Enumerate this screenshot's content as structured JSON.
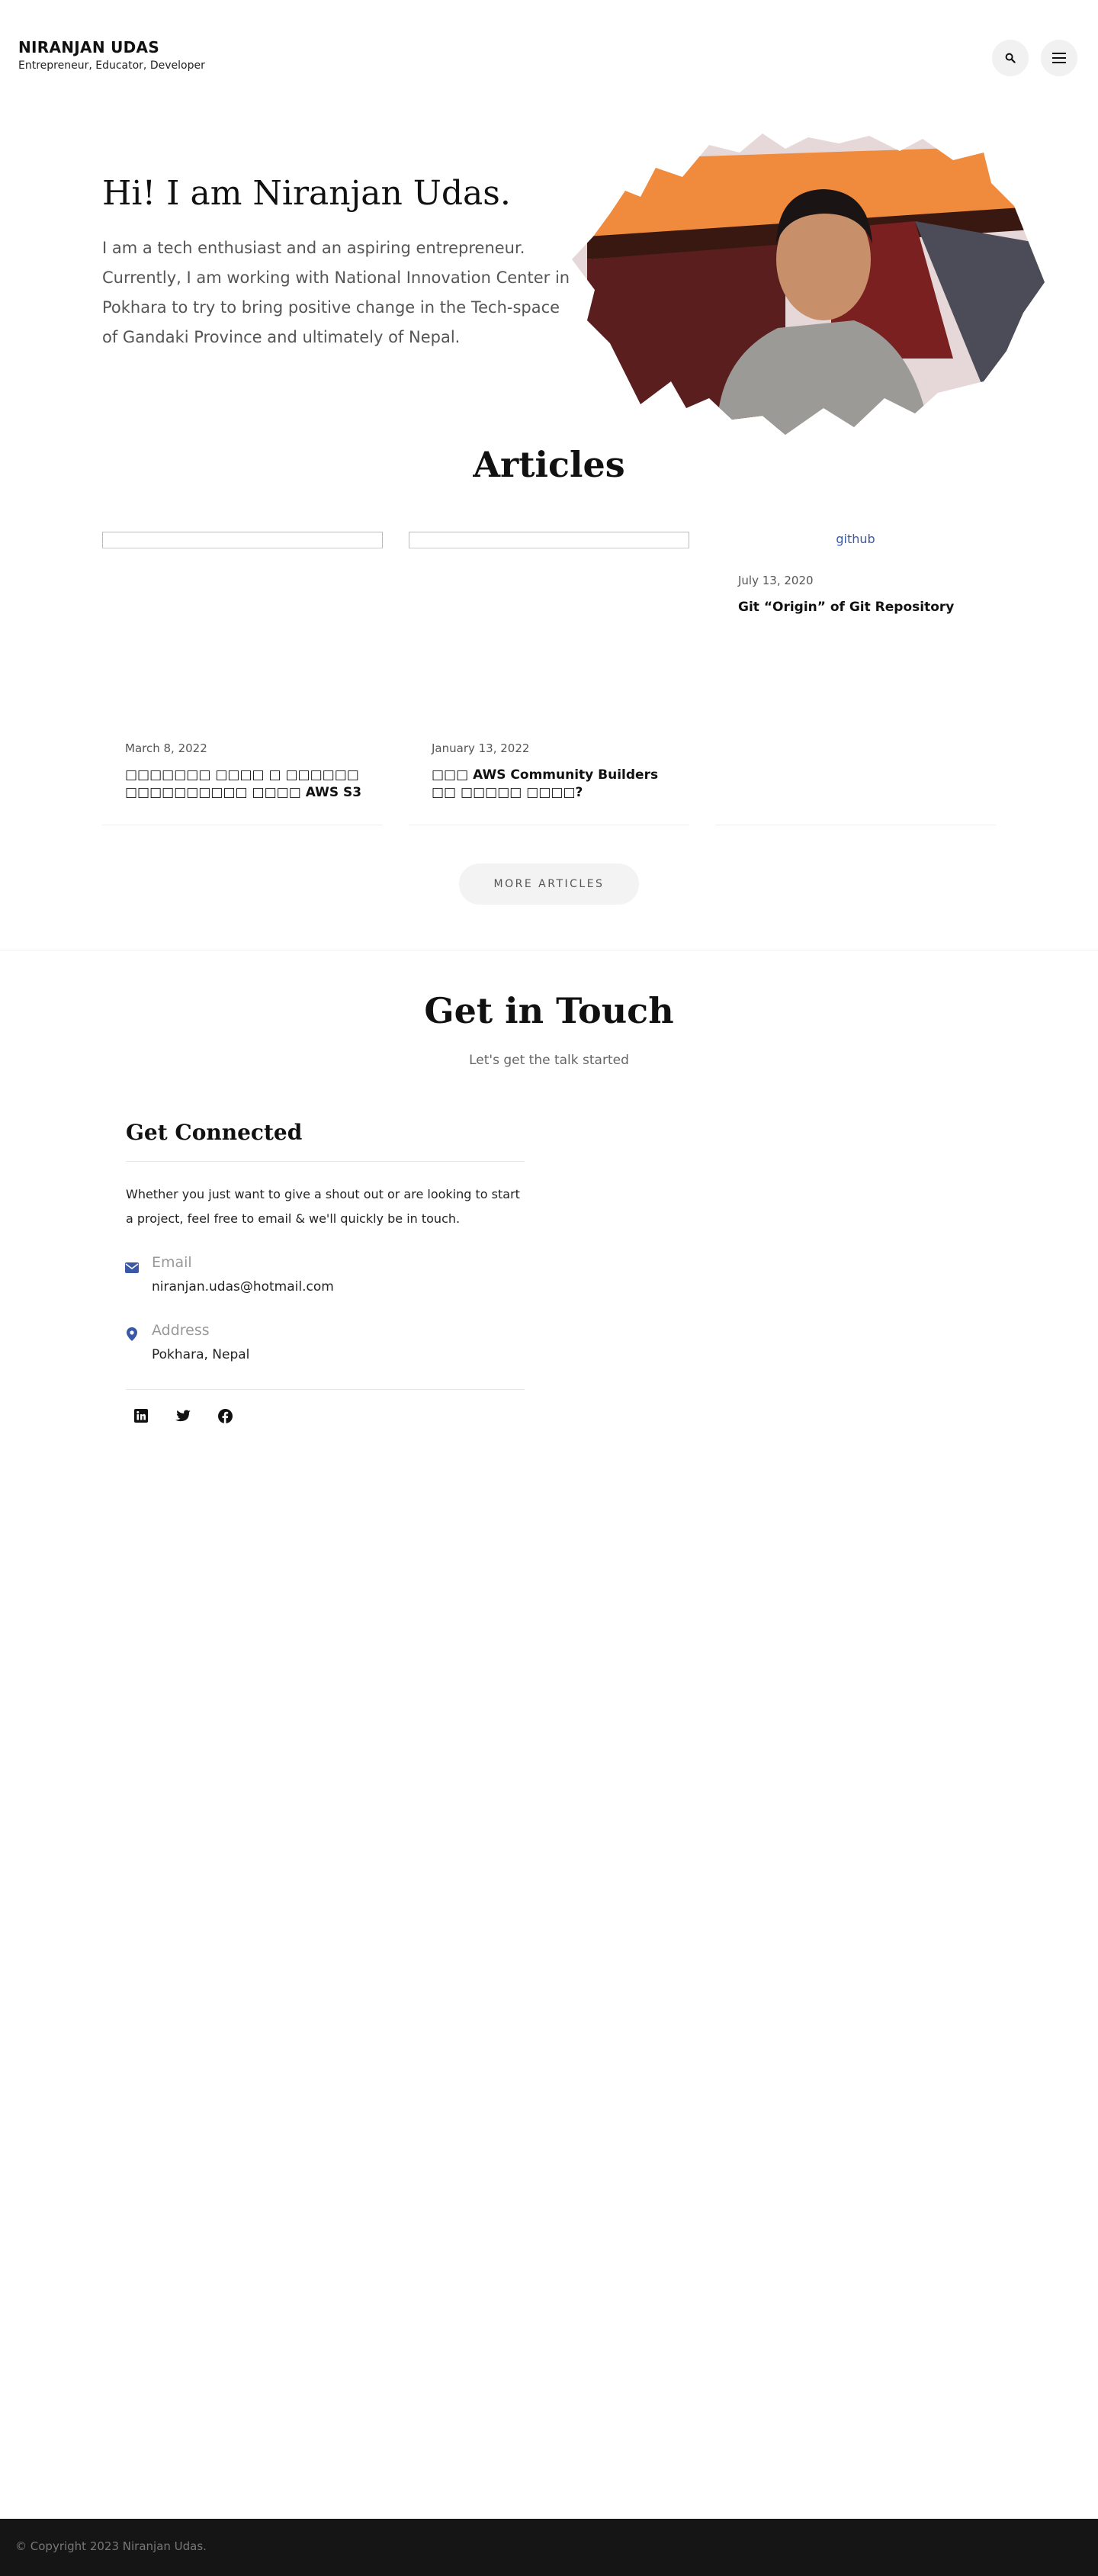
{
  "header": {
    "site_name": "NIRANJAN UDAS",
    "tagline": "Entrepreneur, Educator, Developer",
    "icons": {
      "search": "search-icon",
      "menu": "menu-icon"
    }
  },
  "hero": {
    "title": "Hi! I am Niranjan Udas.",
    "text": "I am a tech enthusiast and an aspiring entrepreneur. Currently, I am working with National Innovation Center in Pokhara to try to bring positive change in the Tech-space of Gandaki Province and ultimately of Nepal."
  },
  "articles": {
    "title": "Articles",
    "items": [
      {
        "date": "March 8, 2022",
        "title": "□□□□□□□ □□□□ □ □□□□□□ □□□□□□□□□□ □□□□ AWS S3"
      },
      {
        "date": "January 13, 2022",
        "title": "□□□ AWS Community Builders □□ □□□□□ □□□□?"
      },
      {
        "date": "July 13, 2020",
        "title": "Git “Origin” of Git Repository",
        "image_alt": "github"
      }
    ],
    "more_label": "MORE ARTICLES"
  },
  "contact": {
    "title": "Get in Touch",
    "subtitle": "Let's get the talk started",
    "box_title": "Get Connected",
    "intro": "Whether you just want to give a shout out or are looking to start a project, feel free to email & we'll quickly be in touch.",
    "email_label": "Email",
    "email_value": "niranjan.udas@hotmail.com",
    "address_label": "Address",
    "address_value": "Pokhara, Nepal",
    "socials": [
      "linkedin-icon",
      "twitter-icon",
      "facebook-icon"
    ]
  },
  "footer": {
    "copyright": "© Copyright 2023 Niranjan Udas."
  },
  "colors": {
    "accent": "#3a57a8",
    "footer_bg": "#151515",
    "text": "#222222",
    "muted": "#555555"
  }
}
